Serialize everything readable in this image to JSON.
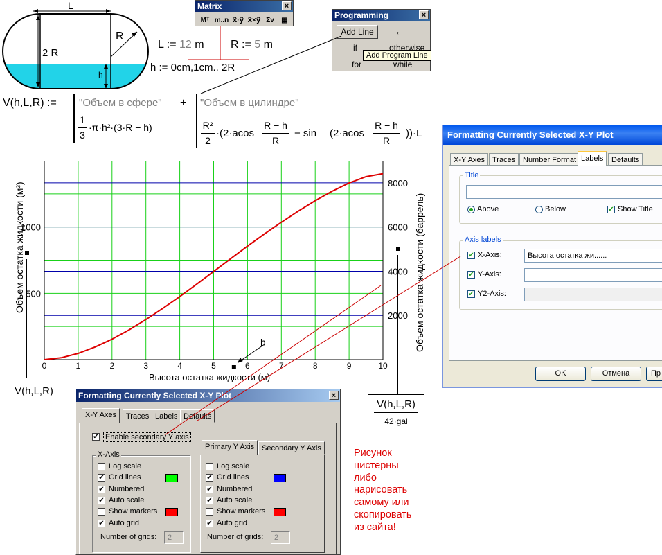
{
  "tank_figure": {
    "length_label": "L",
    "radius_label": "R",
    "diameter_label": "2 R",
    "height_label": "h"
  },
  "definitions": {
    "L_lhs": "L",
    "assign": ":=",
    "L_value": "12",
    "L_unit": "m",
    "R_lhs": "R",
    "R_value": "5",
    "R_unit": "m",
    "h_lhs": "h",
    "h_range_start": "0cm",
    "h_range_step": "1cm",
    "h_range_sep": "..",
    "h_range_end": "2R"
  },
  "matrix_toolbar": {
    "title": "Matrix",
    "buttons": [
      "Mᵀ",
      "m..n",
      "x⃗·y⃗",
      "x⃗×y⃗",
      "Σv",
      "▦"
    ]
  },
  "programming_toolbar": {
    "title": "Programming",
    "add_line": "Add Line",
    "arrow": "←",
    "if": "if",
    "otherwise": "otherwise",
    "for": "for",
    "while": "while",
    "tooltip": "Add Program Line"
  },
  "formula": {
    "lhs": "V(h,L,R)",
    "assign": ":=",
    "comment_sphere": "\"Объем в сфере\"",
    "plus": "+",
    "comment_cylinder": "\"Объем в цилиндре\"",
    "sphere_coef_num": "1",
    "sphere_coef_den": "3",
    "sphere_expr": "·π·h²·(3·R − h)",
    "cyl_r2": "R²",
    "cyl_2": "2",
    "cyl_expr_a": "·(2·acos",
    "cyl_frac_num": "R − h",
    "cyl_frac_den": "R",
    "cyl_minus_sin": "− sin",
    "cyl_expr_b": "(2·acos",
    "cyl_close": "))·L"
  },
  "plot": {
    "y_left_label": "Объем остатка жидкости (м³)",
    "y_right_label": "Объем остатка жидкости  (баррель)",
    "x_label": "Высота остатка жидкости (м)",
    "x_ticks": [
      "0",
      "1",
      "2",
      "3",
      "4",
      "5",
      "6",
      "7",
      "8",
      "9",
      "10"
    ],
    "y_left_ticks": [
      "500",
      "1000"
    ],
    "y_right_ticks": [
      "2000",
      "4000",
      "6000",
      "8000"
    ],
    "h_marker": "h",
    "left_expr": "V(h,L,R)",
    "right_expr_num": "V(h,L,R)",
    "right_expr_den": "42·gal"
  },
  "chart_data": {
    "type": "line",
    "title": "",
    "xlabel": "Высота остатка жидкости (м)",
    "ylabel": "Объем остатка жидкости (м³)",
    "y2label": "Объем остатка жидкости  (баррель)",
    "xlim": [
      0,
      10
    ],
    "ylim": [
      0,
      1500
    ],
    "y2lim": [
      0,
      9000
    ],
    "grid": true,
    "series": [
      {
        "x": [
          0,
          0.5,
          1,
          1.5,
          2,
          2.5,
          3,
          3.5,
          4,
          4.5,
          5,
          5.5,
          6,
          6.5,
          7,
          7.5,
          8,
          8.5,
          9,
          9.5,
          10
        ],
        "y": [
          0,
          14,
          47,
          95,
          154,
          224,
          302,
          386,
          475,
          569,
          665,
          761,
          856,
          948,
          1036,
          1120,
          1199,
          1270,
          1332,
          1380,
          1403
        ]
      }
    ]
  },
  "dialog_xp": {
    "title": "Formatting Currently Selected X-Y Plot",
    "tabs": [
      "X-Y Axes",
      "Traces",
      "Number Format",
      "Labels",
      "Defaults"
    ],
    "title_group": "Title",
    "above": "Above",
    "below": "Below",
    "show_title": "Show Title",
    "axis_group": "Axis labels",
    "x_axis": "X-Axis:",
    "y_axis": "Y-Axis:",
    "y2_axis": "Y2-Axis:",
    "x_axis_value": "Высота остатка жи......",
    "ok": "OK",
    "cancel": "Отмена",
    "apply": "Пр"
  },
  "dialog_2k": {
    "title": "Formatting Currently Selected X-Y Plot",
    "tabs": [
      "X-Y Axes",
      "Traces",
      "Labels",
      "Defaults"
    ],
    "enable_secondary": "Enable secondary Y axis",
    "x_group": "X-Axis",
    "y_tabs": [
      "Primary Y Axis",
      "Secondary Y Axis"
    ],
    "options": [
      "Log scale",
      "Grid lines",
      "Numbered",
      "Auto scale",
      "Show markers",
      "Auto grid"
    ],
    "x_checked": [
      false,
      true,
      true,
      true,
      false,
      true
    ],
    "y_checked": [
      false,
      true,
      true,
      true,
      false,
      true
    ],
    "num_grids_label": "Number of grids:",
    "num_grids_value": "2",
    "x_grid_color": "#00ff00",
    "x_marker_color": "#ff0000",
    "y_grid_color": "#0000ff",
    "y_marker_color": "#ff0000"
  },
  "note": {
    "lines": [
      "Рисунок",
      "цистерны",
      "либо",
      "нарисовать",
      "самому или",
      "скопировать",
      "из сайта!"
    ],
    "color": "#dd0000"
  }
}
